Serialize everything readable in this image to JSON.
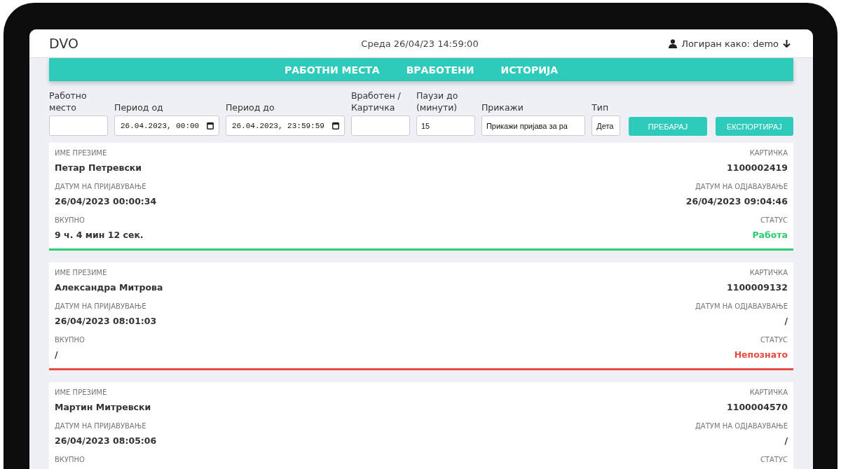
{
  "header": {
    "logo": "DVO",
    "datetime": "Среда 26/04/23 14:59:00",
    "user": "Логиран како: demo"
  },
  "nav": [
    {
      "label": "РАБОТНИ МЕСТА"
    },
    {
      "label": "ВРАБОТЕНИ"
    },
    {
      "label": "ИСТОРИЈА"
    }
  ],
  "filters": [
    {
      "kind": "text",
      "label": "Работно место"
    },
    {
      "kind": "date",
      "label": "Период од",
      "value": "26.04.2023, 00:00"
    },
    {
      "kind": "date",
      "label": "Период до",
      "value": "26.04.2023, 23:59:59"
    },
    {
      "kind": "text",
      "label": "Вработен / Картичка"
    },
    {
      "kind": "text",
      "label": "Паузи до (минути)",
      "value": "15"
    },
    {
      "kind": "select",
      "label": "Прикажи",
      "value": "Прикажи пријава за ра"
    },
    {
      "kind": "select",
      "label": "Тип",
      "value": "Дета"
    }
  ],
  "buttons": [
    "ПРЕБАРАЈ",
    "ЕКСПОРТИРАЈ"
  ],
  "records": [
    {
      "name_label": "ИМЕ ПРЕЗИМЕ",
      "name": "Петар Петревски",
      "card_label": "КАРТИЧКА",
      "card": "1100002419",
      "login_label": "ДАТУМ НА ПРИЈАВУВАЊЕ",
      "login": "26/04/2023 00:00:34",
      "logout_label": "ДАТУМ НА ОДЈАВАУВАЊЕ",
      "logout": "26/04/2023 09:04:46",
      "total_label": "ВКУПНО",
      "total": "9 ч. 4 мин 12 сек.",
      "status_label": "СТАТУС",
      "status": "Работа",
      "color": "#2ecc71"
    },
    {
      "name_label": "ИМЕ ПРЕЗИМЕ",
      "name": "Александра Митрова",
      "card_label": "КАРТИЧКА",
      "card": "1100009132",
      "login_label": "ДАТУМ НА ПРИЈАВУВАЊЕ",
      "login": "26/04/2023 08:01:03",
      "logout_label": "ДАТУМ НА ОДЈАВАУВАЊЕ",
      "logout": "/",
      "total_label": "ВКУПНО",
      "total": "/",
      "status_label": "СТАТУС",
      "status": "Непознато",
      "color": "#e74c3c"
    },
    {
      "name_label": "ИМЕ ПРЕЗИМЕ",
      "name": "Мартин Митревски",
      "card_label": "КАРТИЧКА",
      "card": "1100004570",
      "login_label": "ДАТУМ НА ПРИЈАВУВАЊЕ",
      "login": "26/04/2023 08:05:06",
      "logout_label": "ДАТУМ НА ОДЈАВАУВАЊЕ",
      "logout": "/",
      "total_label": "ВКУПНО",
      "status_label": "СТАТУС"
    }
  ]
}
